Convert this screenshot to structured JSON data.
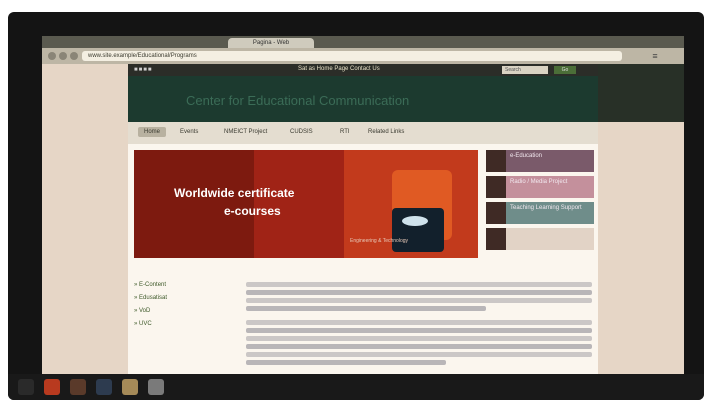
{
  "browser": {
    "tab_title": "Pagina - Web",
    "url": "www.site.example/Educational/Programs",
    "menu_icon": "menu-icon"
  },
  "site": {
    "logo": "■■■■",
    "top_links": "Sat as Home Page   Contact Us",
    "search_placeholder": "Search",
    "search_button": "Go",
    "title": "Center for Educational Communication"
  },
  "nav": [
    "Home",
    "Events",
    "NMEICT Project",
    "CUDSIS",
    "RTI",
    "Related Links"
  ],
  "hero": {
    "line1": "Worldwide certificate",
    "line2": "e-courses",
    "caption": "Engineering & Technology"
  },
  "side_boxes": [
    {
      "label": "e-Education",
      "color": "#7a5a6a"
    },
    {
      "label": "Radio / Media Project",
      "color": "#c4909c"
    },
    {
      "label": "Teaching Learning Support",
      "color": "#6f8d8a"
    },
    {
      "label": "",
      "color": "#e2d3c6"
    }
  ],
  "left_links": [
    "E-Content",
    "Edusatisat",
    "VoD",
    "UVC"
  ],
  "taskbar_icons": [
    {
      "name": "start-icon",
      "color": "#2a2a2a"
    },
    {
      "name": "media-player-icon",
      "color": "#b83a1f"
    },
    {
      "name": "browser-icon",
      "color": "#5a3a2a"
    },
    {
      "name": "explorer-icon",
      "color": "#2d3b4f"
    },
    {
      "name": "folder-icon",
      "color": "#a58a58"
    },
    {
      "name": "app-icon",
      "color": "#7a7a7a"
    }
  ]
}
